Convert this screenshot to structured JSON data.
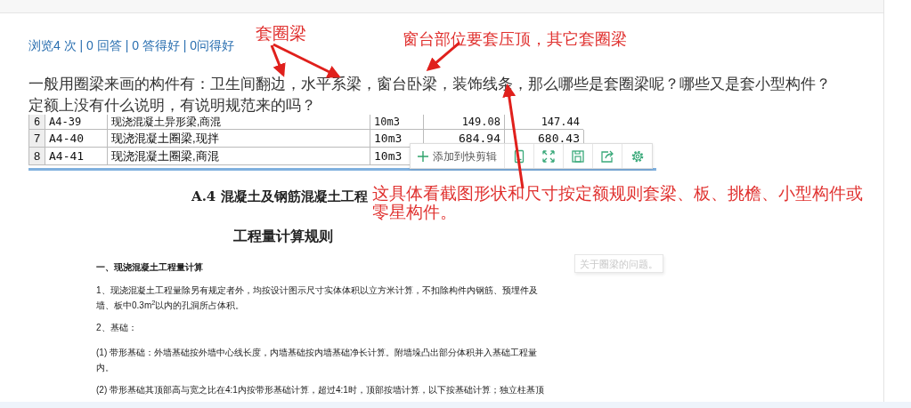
{
  "stats": "浏览4 次 | 0 回答 | 0 答得好 | 0问得好",
  "question": "一般用圈梁来画的构件有：卫生间翻边，水平系梁，窗台卧梁，装饰线条，那么哪些是套圈梁呢？哪些又是套小型构件？定额上没有什么说明，有说明规范来的吗？",
  "quota_table": {
    "rows": [
      {
        "index": "6",
        "code": "A4-39",
        "name": "现浇混凝土异形梁,商混",
        "unit": "10m3",
        "column_5": "149.08",
        "column_6": "147.44"
      },
      {
        "index": "7",
        "code": "A4-40",
        "name": "现浇混凝土圈梁,现拌",
        "unit": "10m3",
        "column_5": "684.94",
        "column_6": "680.43"
      },
      {
        "index": "8",
        "code": "A4-41",
        "name": "现浇混凝土圈梁,商混",
        "unit": "10m3"
      }
    ]
  },
  "clip_toolbar": {
    "label": "添加到快剪辑"
  },
  "document": {
    "heading": "A.4  混凝土及钢筋混凝土工程",
    "subheading": "工程量计算规则",
    "lines": [
      {
        "kind": "title",
        "text": "一、现浇混凝土工程量计算"
      },
      {
        "kind": "para",
        "text": "1、现浇混凝土工程量除另有规定者外，均按设计图示尺寸实体体积以立方米计算，不扣除构件内钢筋、预埋件及"
      },
      {
        "kind": "cont",
        "text": "墙、板中0.3m$^{2}$以内的孔洞所占体积。"
      },
      {
        "kind": "para",
        "text": "2、基础："
      },
      {
        "kind": "para",
        "text": "(1) 带形基础：外墙基础按外墙中心线长度，内墙基础按内墙基础净长计算。附墙垛凸出部分体积并入基础工程量"
      },
      {
        "kind": "cont",
        "text": "内。"
      },
      {
        "kind": "para",
        "text": "(2) 带形基础其顶部高与宽之比在4:1内按带形基础计算，超过4:1时，顶部按墙计算，以下按基础计算；独立柱基顶"
      }
    ]
  },
  "tooltip": "关于圈梁的问题。",
  "annotations": [
    {
      "text": "套圈梁"
    },
    {
      "text": "窗台部位要套压顶，其它套圈梁"
    },
    {
      "text": "这具体看截图形状和尺寸按定额规则套梁、板、挑檐、小型构件或零星构件。"
    }
  ]
}
